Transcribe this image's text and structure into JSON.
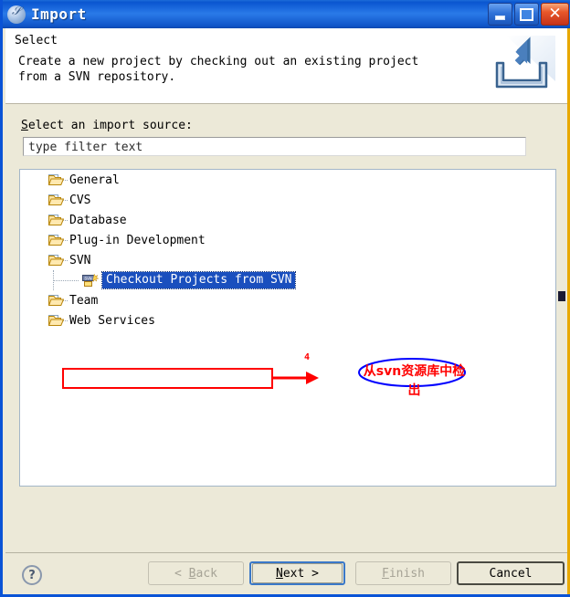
{
  "window": {
    "title": "Import",
    "icon": "eclipse-icon",
    "controls": {
      "minimize": "minimize-button",
      "maximize": "maximize-button",
      "close": "close-button"
    }
  },
  "header": {
    "title": "Select",
    "description": "Create a new project by checking out an existing project from a SVN repository.",
    "icon": "import-wizard-icon"
  },
  "main": {
    "source_label_prefix": "S",
    "source_label_rest": "elect an import source:",
    "filter": {
      "value": "type filter text",
      "placeholder": "type filter text"
    },
    "tree": [
      {
        "label": "General",
        "level": 1,
        "expander": "+",
        "icon": "folder-icon",
        "selected": false
      },
      {
        "label": "CVS",
        "level": 1,
        "expander": "+",
        "icon": "folder-icon",
        "selected": false
      },
      {
        "label": "Database",
        "level": 1,
        "expander": "+",
        "icon": "folder-icon",
        "selected": false
      },
      {
        "label": "Plug-in Development",
        "level": 1,
        "expander": "+",
        "icon": "folder-icon",
        "selected": false
      },
      {
        "label": "SVN",
        "level": 1,
        "expander": "-",
        "icon": "folder-icon",
        "selected": false
      },
      {
        "label": "Checkout Projects from SVN",
        "level": 2,
        "expander": "",
        "icon": "svn-checkout-icon",
        "selected": true
      },
      {
        "label": "Team",
        "level": 1,
        "expander": "+",
        "icon": "folder-icon",
        "selected": false
      },
      {
        "label": "Web Services",
        "level": 1,
        "expander": "+",
        "icon": "folder-icon",
        "selected": false
      }
    ]
  },
  "annotation": {
    "text": "从svn资源库中检出",
    "marker": "4",
    "rect_color": "#ff0000",
    "arrow_color": "#ff0000",
    "ellipse_color": "#0000ff",
    "text_color": "#ff0000"
  },
  "footer": {
    "help": "?",
    "buttons": {
      "back": {
        "prefix": "< ",
        "accel": "B",
        "rest": "ack",
        "disabled": true,
        "default": false
      },
      "next": {
        "prefix": "",
        "accel": "N",
        "rest": "ext >",
        "disabled": false,
        "default": true
      },
      "finish": {
        "prefix": "",
        "accel": "F",
        "rest": "inish",
        "disabled": true,
        "default": false
      },
      "cancel": {
        "prefix": "",
        "accel": "",
        "rest": "Cancel",
        "disabled": false,
        "default": false
      }
    }
  },
  "colors": {
    "titlebar": "#0a55d0",
    "body": "#ece9d8",
    "selection": "#1a4fbe",
    "border": "#0a53d6",
    "edge_accent": "#e8a800"
  }
}
